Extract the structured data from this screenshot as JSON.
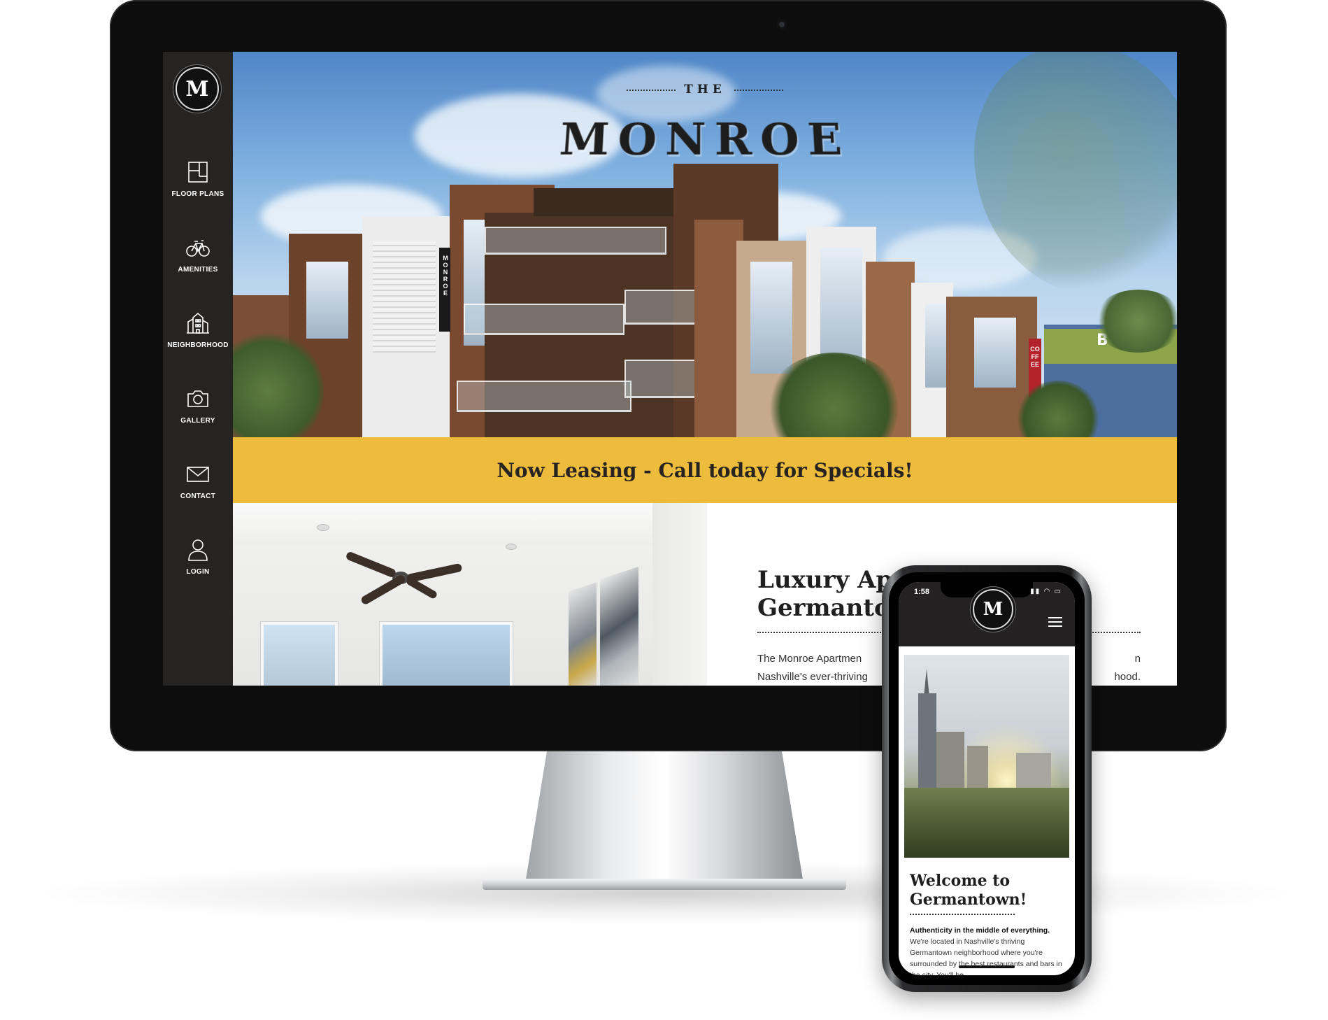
{
  "sidebar": {
    "logo_letter": "M",
    "items": [
      {
        "label": "FLOOR PLANS",
        "icon": "floor-plan-icon"
      },
      {
        "label": "AMENITIES",
        "icon": "bicycle-icon"
      },
      {
        "label": "NEIGHBORHOOD",
        "icon": "buildings-icon"
      },
      {
        "label": "GALLERY",
        "icon": "camera-icon"
      },
      {
        "label": "CONTACT",
        "icon": "envelope-icon"
      },
      {
        "label": "LOGIN",
        "icon": "user-icon"
      }
    ]
  },
  "hero": {
    "pre_title": "THE",
    "title": "MONROE",
    "sign_text": "MONROE",
    "coffee_sign": "COFFEE",
    "store_letter": "B"
  },
  "banner": {
    "text": "Now Leasing - Call today for Specials!"
  },
  "content": {
    "title": "Luxury Ap\nGermanto",
    "text_line1": "The Monroe Apartmen",
    "text_line1_tail": "n",
    "text_line2": "Nashville's ever-thriving",
    "text_line2_tail": "hood."
  },
  "phone": {
    "status_time": "1:58",
    "logo_letter": "M",
    "title": "Welcome to\nGermantown!",
    "intro_bold": "Authenticity in the middle of everything.",
    "intro_text": " We're located in Nashville's thriving Germantown neighborhood where you're surrounded by the best restaurants and bars in the city. You'll be"
  },
  "colors": {
    "sidebar_bg": "#262423",
    "banner_bg": "#eebc3c",
    "text_dark": "#1f1f1f"
  }
}
